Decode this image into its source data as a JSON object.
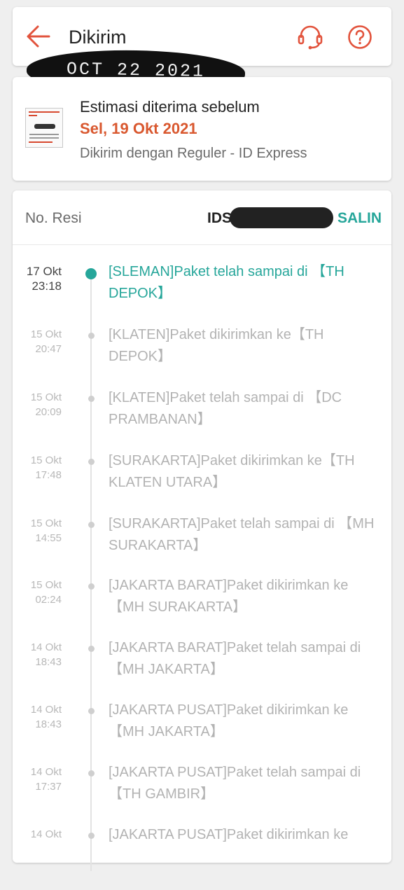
{
  "header": {
    "title": "Dikirim",
    "back_icon": "arrow-left-icon",
    "support_icon": "headset-icon",
    "help_icon": "question-circle-icon",
    "accent_color": "#e2533c"
  },
  "handwritten_note": "OCT 22 2021",
  "estimate": {
    "title": "Estimasi diterima sebelum",
    "date": "Sel, 19 Okt 2021",
    "shipping": "Dikirim dengan Reguler - ID Express",
    "date_color": "#d9582f"
  },
  "tracking": {
    "resi_label": "No. Resi",
    "resi_prefix": "IDS",
    "copy_label": "SALIN",
    "accent_color": "#26a69a",
    "entries": [
      {
        "date": "17 Okt",
        "time": "23:18",
        "text": "[SLEMAN]Paket telah sampai di 【TH DEPOK】"
      },
      {
        "date": "15 Okt",
        "time": "20:47",
        "text": "[KLATEN]Paket dikirimkan ke【TH DEPOK】"
      },
      {
        "date": "15 Okt",
        "time": "20:09",
        "text": "[KLATEN]Paket telah sampai di 【DC PRAMBANAN】"
      },
      {
        "date": "15 Okt",
        "time": "17:48",
        "text": "[SURAKARTA]Paket dikirimkan ke【TH KLATEN UTARA】"
      },
      {
        "date": "15 Okt",
        "time": "14:55",
        "text": "[SURAKARTA]Paket telah sampai di 【MH SURAKARTA】"
      },
      {
        "date": "15 Okt",
        "time": "02:24",
        "text": "[JAKARTA BARAT]Paket dikirimkan ke 【MH SURAKARTA】"
      },
      {
        "date": "14 Okt",
        "time": "18:43",
        "text": "[JAKARTA BARAT]Paket telah sampai di 【MH JAKARTA】"
      },
      {
        "date": "14 Okt",
        "time": "18:43",
        "text": "[JAKARTA PUSAT]Paket dikirimkan ke 【MH JAKARTA】"
      },
      {
        "date": "14 Okt",
        "time": "17:37",
        "text": "[JAKARTA PUSAT]Paket telah sampai di 【TH GAMBIR】"
      },
      {
        "date": "14 Okt",
        "time": "",
        "text": "[JAKARTA PUSAT]Paket dikirimkan ke"
      }
    ]
  }
}
